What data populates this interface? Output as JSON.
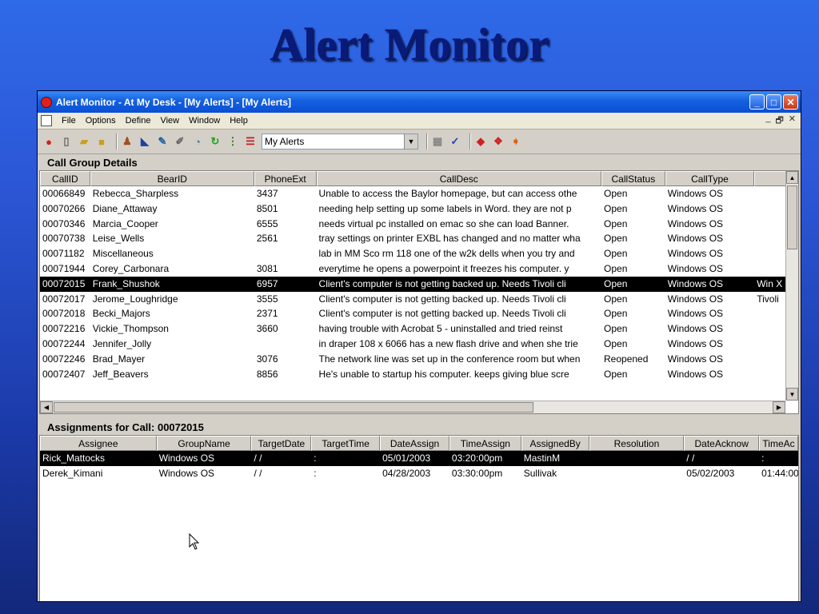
{
  "slide_title": "Alert Monitor",
  "window": {
    "title": "Alert Monitor - At My Desk - [My Alerts] - [My Alerts]",
    "controls": [
      "_",
      "□",
      "✕"
    ]
  },
  "menubar": {
    "items": [
      "File",
      "Options",
      "Define",
      "View",
      "Window",
      "Help"
    ],
    "mdi_controls": [
      "_",
      "🗗",
      "✕"
    ]
  },
  "toolbar": {
    "dropdown_value": "My Alerts"
  },
  "call_group": {
    "title": "Call Group Details",
    "columns": [
      "CallID",
      "BearID",
      "PhoneExt",
      "CallDesc",
      "CallStatus",
      "CallType",
      ""
    ],
    "rows": [
      [
        "00066849",
        "Rebecca_Sharpless",
        "3437",
        "Unable to access the Baylor homepage, but can access othe",
        "Open",
        "Windows OS",
        ""
      ],
      [
        "00070266",
        "Diane_Attaway",
        "8501",
        "needing help setting up some labels in Word.  they are not p",
        "Open",
        "Windows OS",
        ""
      ],
      [
        "00070346",
        "Marcia_Cooper",
        "6555",
        "needs virtual pc installed on emac so she can load Banner.",
        "Open",
        "Windows OS",
        ""
      ],
      [
        "00070738",
        "Leise_Wells",
        "2561",
        "tray settings on printer EXBL has changed and no matter wha",
        "Open",
        "Windows OS",
        ""
      ],
      [
        "00071182",
        "Miscellaneous",
        "",
        "lab in MM Sco rm 118 one of the w2k dells when you try and",
        "Open",
        "Windows OS",
        ""
      ],
      [
        "00071944",
        "Corey_Carbonara",
        "3081",
        "everytime he  opens a powerpoint it freezes his computer.  y",
        "Open",
        "Windows OS",
        ""
      ],
      [
        "00072015",
        "Frank_Shushok",
        "6957",
        "Client's computer is not getting backed up. Needs Tivoli cli",
        "Open",
        "Windows OS",
        "Win X"
      ],
      [
        "00072017",
        "Jerome_Loughridge",
        "3555",
        "Client's computer is not getting backed up. Needs Tivoli cli",
        "Open",
        "Windows OS",
        "Tivoli"
      ],
      [
        "00072018",
        "Becki_Majors",
        "2371",
        "Client's computer is not getting backed up. Needs Tivoli cli",
        "Open",
        "Windows OS",
        ""
      ],
      [
        "00072216",
        "Vickie_Thompson",
        "3660",
        "having trouble with Acrobat 5 - uninstalled and tried reinst",
        "Open",
        "Windows OS",
        ""
      ],
      [
        "00072244",
        "Jennifer_Jolly",
        "",
        "in draper 108 x 6066 has a new flash drive and when she trie",
        "Open",
        "Windows OS",
        ""
      ],
      [
        "00072246",
        "Brad_Mayer",
        "3076",
        "The network line was set up in the conference room but when",
        "Reopened",
        "Windows OS",
        ""
      ],
      [
        "00072407",
        "Jeff_Beavers",
        "8856",
        "He's unable to startup his computer.  keeps giving blue scre",
        "Open",
        "Windows OS",
        ""
      ]
    ],
    "selected_row": 6
  },
  "assignments": {
    "title": "Assignments for Call: 00072015",
    "columns": [
      "Assignee",
      "GroupName",
      "TargetDate",
      "TargetTime",
      "DateAssign",
      "TimeAssign",
      "AssignedBy",
      "Resolution",
      "DateAcknow",
      "TimeAc"
    ],
    "rows": [
      [
        "Rick_Mattocks",
        "Windows OS",
        "/ /",
        ":",
        "05/01/2003",
        "03:20:00pm",
        "MastinM",
        "",
        "/ /",
        ":"
      ],
      [
        "Derek_Kimani",
        "Windows OS",
        "/ /",
        ":",
        "04/28/2003",
        "03:30:00pm",
        "Sullivak",
        "",
        "05/02/2003",
        "01:44:00"
      ]
    ],
    "selected_row": 0
  }
}
